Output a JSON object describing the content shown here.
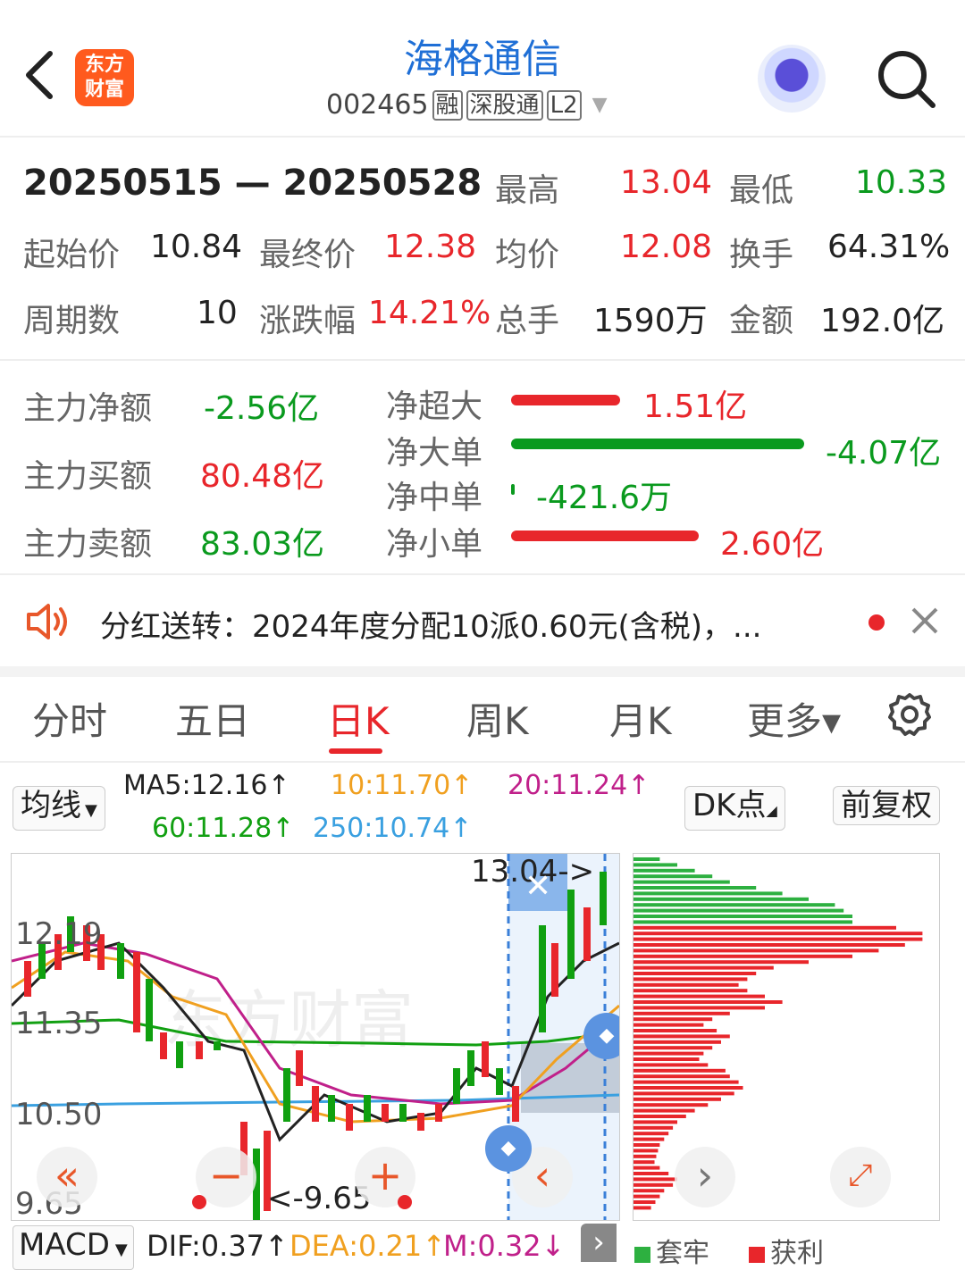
{
  "header": {
    "back_icon": "chevron-left-icon",
    "logo_text": "东方财富",
    "title": "海格通信",
    "code": "002465",
    "tags": [
      "融",
      "深股通",
      "L2"
    ],
    "search_icon": "search-icon"
  },
  "stats": {
    "date_range": "20250515 — 20250528",
    "high_label": "最高",
    "high": "13.04",
    "low_label": "最低",
    "low": "10.33",
    "open_label": "起始价",
    "open": "10.84",
    "close_label": "最终价",
    "close": "12.38",
    "avg_label": "均价",
    "avg": "12.08",
    "turnover_label": "换手",
    "turnover": "64.31%",
    "periods_label": "周期数",
    "periods": "10",
    "change_label": "涨跌幅",
    "change": "14.21%",
    "volume_label": "总手",
    "volume": "1590万",
    "amount_label": "金额",
    "amount": "192.0亿"
  },
  "fund_flow": {
    "main_net_label": "主力净额",
    "main_net": "-2.56亿",
    "main_buy_label": "主力买额",
    "main_buy": "80.48亿",
    "main_sell_label": "主力卖额",
    "main_sell": "83.03亿",
    "rows": [
      {
        "label": "净超大",
        "value": "1.51亿",
        "amount": 1.51,
        "color": "#e8262b"
      },
      {
        "label": "净大单",
        "value": "-4.07亿",
        "amount": -4.07,
        "color": "#0a9a1e"
      },
      {
        "label": "净中单",
        "value": "-421.6万",
        "amount": -0.04216,
        "color": "#0a9a1e"
      },
      {
        "label": "净小单",
        "value": "2.60亿",
        "amount": 2.6,
        "color": "#e8262b"
      }
    ]
  },
  "notice": {
    "icon": "speaker-icon",
    "text": "分红送转：2024年度分配10派0.60元(含税)，...",
    "close_icon": "close-icon"
  },
  "tabs": [
    "分时",
    "五日",
    "日K",
    "周K",
    "月K",
    "更多▾"
  ],
  "active_tab": "日K",
  "settings_icon": "gear-icon",
  "indicators": {
    "ma_selector": "均线",
    "ma5": "MA5:12.16↑",
    "ma10": "10:11.70↑",
    "ma20": "20:11.24↑",
    "ma60": "60:11.28↑",
    "ma250": "250:10.74↑",
    "dk_button": "DK点",
    "adjust_button": "前复权",
    "colors": {
      "ma5": "#222222",
      "ma10": "#f0a020",
      "ma20": "#c0208a",
      "ma60": "#12a012",
      "ma250": "#3aa0e0"
    }
  },
  "kchart": {
    "price_labels": [
      "12.19",
      "11.35",
      "10.50",
      "9.65"
    ],
    "top_label": "13.04->",
    "low_label": "<-9.65",
    "watermark": "东方财富"
  },
  "distribution_legend": {
    "trapped": "套牢",
    "profit": "获利"
  },
  "macd": {
    "selector": "MACD",
    "dif": "DIF:0.37↑",
    "dea": "DEA:0.21↑",
    "m": "M:0.32↓"
  }
}
